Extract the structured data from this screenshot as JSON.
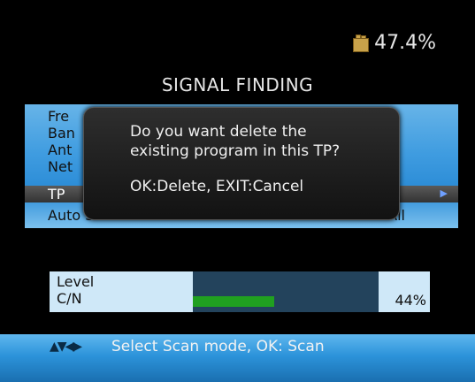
{
  "status": {
    "battery_text": "47.4%"
  },
  "header": {
    "title": "SIGNAL FINDING"
  },
  "menu": {
    "items": [
      {
        "label": "Fre"
      },
      {
        "label": "Ban"
      },
      {
        "label": "Ant"
      },
      {
        "label": "Net"
      },
      {
        "label": "TP"
      },
      {
        "label": "Auto Scan",
        "value": "All"
      }
    ],
    "selected_index": 4
  },
  "dialog": {
    "question_line1": "Do you want delete the",
    "question_line2": "existing program in this TP?",
    "options": "OK:Delete, EXIT:Cancel"
  },
  "meter": {
    "level_label": "Level",
    "cn_label": "C/N",
    "cn_percent_text": "44%",
    "cn_fraction": 0.44
  },
  "footer": {
    "help_text": "Select Scan mode, OK: Scan"
  },
  "icons": {
    "battery": "battery-icon",
    "nav": "navigation-arrows-icon",
    "right": "right-arrow-icon"
  }
}
